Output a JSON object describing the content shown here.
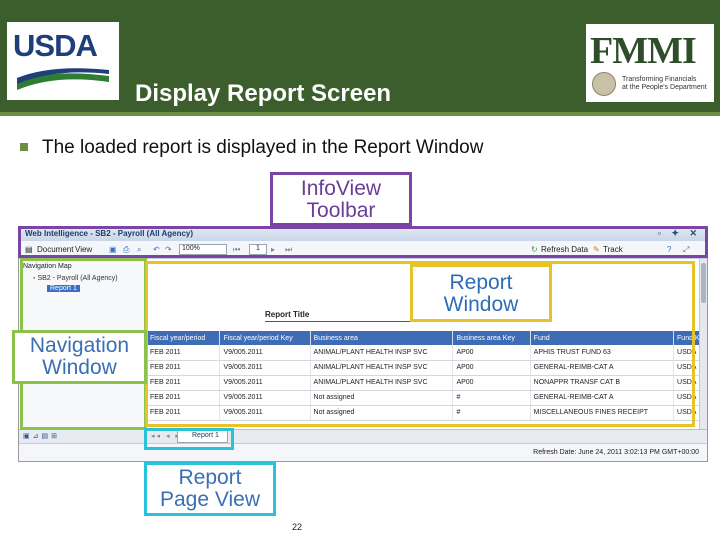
{
  "slide": {
    "title": "Display Report Screen",
    "bullet": "The loaded report is displayed in the Report Window",
    "page_number": "22",
    "usda_logo_text": "USDA",
    "fmmi_logo_text": "FMMI",
    "fmmi_tagline_1": "Transforming Financials",
    "fmmi_tagline_2": "at the People's Department"
  },
  "callouts": {
    "infoview_1": "InfoView",
    "infoview_2": "Toolbar",
    "report_1": "Report",
    "report_2": "Window",
    "nav_1": "Navigation",
    "nav_2": "Window",
    "page_1": "Report",
    "page_2": "Page View"
  },
  "app": {
    "title": "Web Intelligence - SB2 - Payroll (All Agency)",
    "toolbar": {
      "document": "Document",
      "view": "View",
      "zoom": "100%",
      "page": "1",
      "refresh": "Refresh Data",
      "track": "Track"
    },
    "nav": {
      "heading": "Navigation Map",
      "doc_node": "SB2 - Payroll (All Agency)",
      "report_node": "Report 1"
    },
    "report": {
      "title": "Report Title",
      "columns": [
        "Fiscal year/period",
        "Fiscal year/period Key",
        "Business area",
        "Business area Key",
        "Fund",
        "Fund K"
      ],
      "rows": [
        [
          "FEB 2011",
          "V9/005.2011",
          "ANIMAL/PLANT HEALTH INSP SVC",
          "AP00",
          "APHIS TRUST FUND 63",
          "USDA"
        ],
        [
          "FEB 2011",
          "V9/005.2011",
          "ANIMAL/PLANT HEALTH INSP SVC",
          "AP00",
          "GENERAL-REIMB-CAT A",
          "USDA"
        ],
        [
          "FEB 2011",
          "V9/005.2011",
          "ANIMAL/PLANT HEALTH INSP SVC",
          "AP00",
          "NONAPPR TRANSF CAT B",
          "USDA"
        ],
        [
          "FEB 2011",
          "V9/005.2011",
          "Not assigned",
          "#",
          "GENERAL-REIMB-CAT A",
          "USDA"
        ],
        [
          "FEB 2011",
          "V9/005.2011",
          "Not assigned",
          "#",
          "MISCELLANEOUS FINES RECEIPT",
          "USDA"
        ]
      ]
    },
    "tab": "Report 1",
    "status": "Refresh Date: June 24, 2011 3:02:13 PM GMT+00:00"
  },
  "colors": {
    "banner": "#3b5e2c",
    "infoview": "#7b45a8",
    "report_window": "#e8c22a",
    "navigation": "#8bc34a",
    "page_view": "#29c2d9",
    "grid_header": "#3f6db5"
  }
}
